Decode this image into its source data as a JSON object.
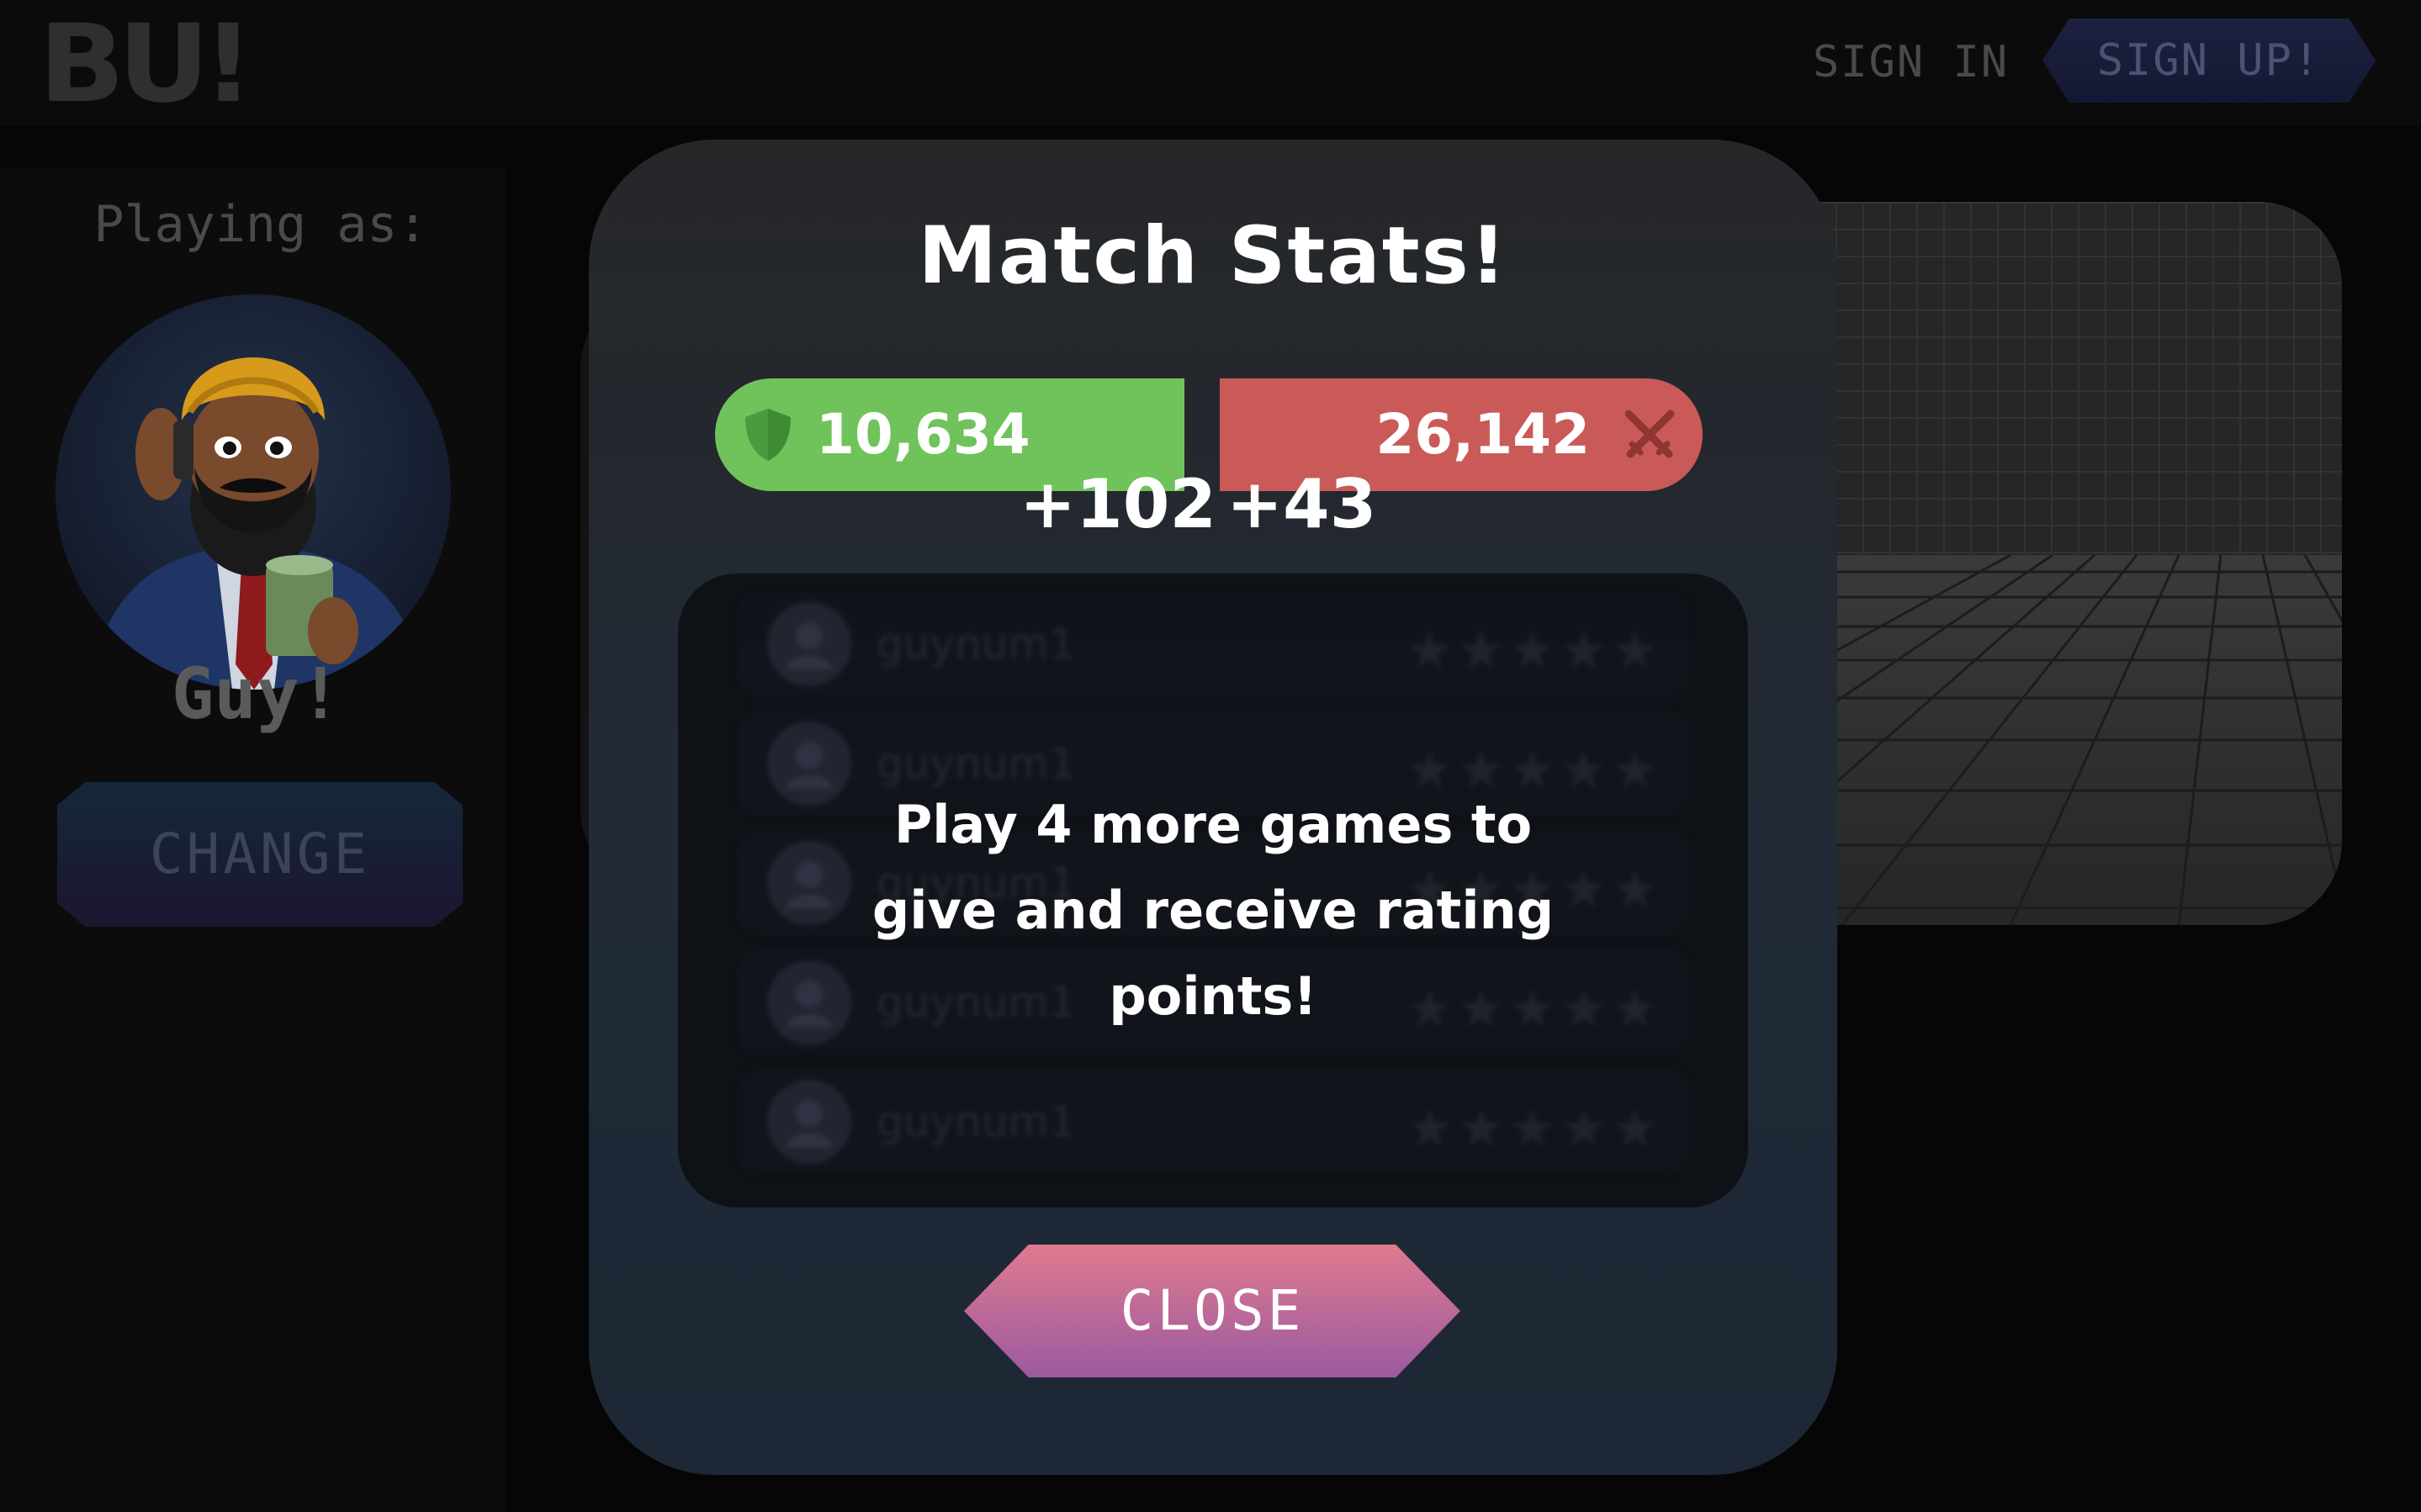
{
  "header": {
    "logo_text": "BU!",
    "sign_in_label": "SIGN IN",
    "sign_up_label": "SIGN UP!"
  },
  "sidebar": {
    "playing_as_label": "Playing as:",
    "player_name": "Guy!",
    "change_label": "CHANGE"
  },
  "modal": {
    "title": "Match Stats!",
    "defense_score": "10,634",
    "attack_score": "26,142",
    "defense_delta": "+102",
    "attack_delta": "+43",
    "lock_message": "Play 4 more games to give and receive rating points!",
    "close_label": "CLOSE",
    "rating_rows": [
      {
        "name": "guynum1",
        "stars": "★★★★★"
      },
      {
        "name": "guynum1",
        "stars": "★★★★★"
      },
      {
        "name": "guynum1",
        "stars": "★★★★★"
      },
      {
        "name": "guynum1",
        "stars": "★★★★★"
      },
      {
        "name": "guynum1",
        "stars": "★★★★★"
      }
    ]
  },
  "colors": {
    "defense_bar": "#6fc35a",
    "attack_bar": "#c95a58",
    "close_button_top": "#e07a8f",
    "close_button_bottom": "#9a5aa0"
  },
  "icons": {
    "defense": "shield-icon",
    "attack": "crossed-swords-icon"
  }
}
